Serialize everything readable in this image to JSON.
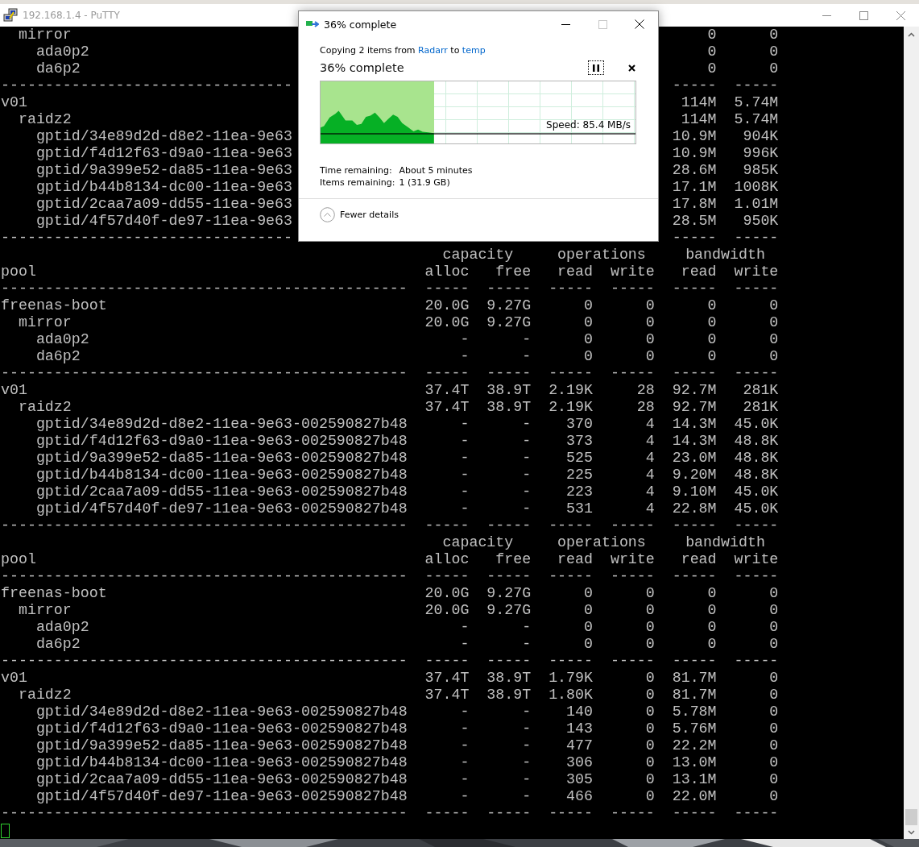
{
  "putty": {
    "title": "192.168.1.4 - PuTTY"
  },
  "terminal": {
    "lines": [
      {
        "kind": "pool",
        "children": [
          {
            "name": "mirror",
            "values": {
              "bw_read": "0",
              "bw_write": "0"
            },
            "children": [
              {
                "name": "ada0p2",
                "values": {
                  "bw_read": "0",
                  "bw_write": "0"
                }
              },
              {
                "name": "da6p2",
                "values": {
                  "bw_read": "0",
                  "bw_write": "0"
                }
              }
            ]
          }
        ]
      },
      {
        "kind": "separator",
        "name": "---------------------------------",
        "cells": {
          "bw_read": "-----",
          "bw_write": "-----"
        }
      },
      {
        "kind": "pool",
        "name": "v01",
        "values": {
          "bw_read": "114M",
          "bw_write": "5.74M"
        },
        "children": [
          {
            "name": "raidz2",
            "values": {
              "bw_read": "114M",
              "bw_write": "5.74M"
            },
            "children": [
              {
                "name": "gptid/34e89d2d-d8e2-11ea-9e63",
                "values": {
                  "bw_read": "10.9M",
                  "bw_write": "904K"
                }
              },
              {
                "name": "gptid/f4d12f63-d9a0-11ea-9e63",
                "values": {
                  "bw_read": "10.9M",
                  "bw_write": "996K"
                }
              },
              {
                "name": "gptid/9a399e52-da85-11ea-9e63",
                "values": {
                  "bw_read": "28.6M",
                  "bw_write": "985K"
                }
              },
              {
                "name": "gptid/b44b8134-dc00-11ea-9e63",
                "values": {
                  "bw_read": "17.1M",
                  "bw_write": "1008K"
                }
              },
              {
                "name": "gptid/2caa7a09-dd55-11ea-9e63",
                "values": {
                  "bw_read": "17.8M",
                  "bw_write": "1.01M"
                }
              },
              {
                "name": "gptid/4f57d40f-de97-11ea-9e63",
                "values": {
                  "bw_read": "28.5M",
                  "bw_write": "950K"
                }
              }
            ]
          }
        ]
      },
      {
        "kind": "separator",
        "name": "---------------------------------",
        "cells": {
          "bw_read": "-----",
          "bw_write": "-----"
        }
      },
      {
        "kind": "groups",
        "groups": [
          "capacity",
          "operations",
          "bandwidth"
        ]
      },
      {
        "kind": "columns",
        "label": "pool",
        "columns": [
          "alloc",
          "free",
          "read",
          "write",
          "read",
          "write"
        ]
      },
      {
        "kind": "separator",
        "name": "----------------------------------------------",
        "cells": {
          "alloc": "-----",
          "free": "-----",
          "ops_read": "-----",
          "ops_write": "-----",
          "bw_read": "-----",
          "bw_write": "-----"
        }
      },
      {
        "kind": "pool",
        "name": "freenas-boot",
        "values": {
          "alloc": "20.0G",
          "free": "9.27G",
          "ops_read": "0",
          "ops_write": "0",
          "bw_read": "0",
          "bw_write": "0"
        },
        "children": [
          {
            "name": "mirror",
            "values": {
              "alloc": "20.0G",
              "free": "9.27G",
              "ops_read": "0",
              "ops_write": "0",
              "bw_read": "0",
              "bw_write": "0"
            },
            "children": [
              {
                "name": "ada0p2",
                "values": {
                  "alloc": "-",
                  "free": "-",
                  "ops_read": "0",
                  "ops_write": "0",
                  "bw_read": "0",
                  "bw_write": "0"
                }
              },
              {
                "name": "da6p2",
                "values": {
                  "alloc": "-",
                  "free": "-",
                  "ops_read": "0",
                  "ops_write": "0",
                  "bw_read": "0",
                  "bw_write": "0"
                }
              }
            ]
          }
        ]
      },
      {
        "kind": "separator",
        "name": "----------------------------------------------",
        "cells": {
          "alloc": "-----",
          "free": "-----",
          "ops_read": "-----",
          "ops_write": "-----",
          "bw_read": "-----",
          "bw_write": "-----"
        }
      },
      {
        "kind": "pool",
        "name": "v01",
        "values": {
          "alloc": "37.4T",
          "free": "38.9T",
          "ops_read": "2.19K",
          "ops_write": "28",
          "bw_read": "92.7M",
          "bw_write": "281K"
        },
        "children": [
          {
            "name": "raidz2",
            "values": {
              "alloc": "37.4T",
              "free": "38.9T",
              "ops_read": "2.19K",
              "ops_write": "28",
              "bw_read": "92.7M",
              "bw_write": "281K"
            },
            "children": [
              {
                "name": "gptid/34e89d2d-d8e2-11ea-9e63-002590827b48",
                "values": {
                  "alloc": "-",
                  "free": "-",
                  "ops_read": "370",
                  "ops_write": "4",
                  "bw_read": "14.3M",
                  "bw_write": "45.0K"
                }
              },
              {
                "name": "gptid/f4d12f63-d9a0-11ea-9e63-002590827b48",
                "values": {
                  "alloc": "-",
                  "free": "-",
                  "ops_read": "373",
                  "ops_write": "4",
                  "bw_read": "14.3M",
                  "bw_write": "48.8K"
                }
              },
              {
                "name": "gptid/9a399e52-da85-11ea-9e63-002590827b48",
                "values": {
                  "alloc": "-",
                  "free": "-",
                  "ops_read": "525",
                  "ops_write": "4",
                  "bw_read": "23.0M",
                  "bw_write": "48.8K"
                }
              },
              {
                "name": "gptid/b44b8134-dc00-11ea-9e63-002590827b48",
                "values": {
                  "alloc": "-",
                  "free": "-",
                  "ops_read": "225",
                  "ops_write": "4",
                  "bw_read": "9.20M",
                  "bw_write": "48.8K"
                }
              },
              {
                "name": "gptid/2caa7a09-dd55-11ea-9e63-002590827b48",
                "values": {
                  "alloc": "-",
                  "free": "-",
                  "ops_read": "223",
                  "ops_write": "4",
                  "bw_read": "9.10M",
                  "bw_write": "45.0K"
                }
              },
              {
                "name": "gptid/4f57d40f-de97-11ea-9e63-002590827b48",
                "values": {
                  "alloc": "-",
                  "free": "-",
                  "ops_read": "531",
                  "ops_write": "4",
                  "bw_read": "22.8M",
                  "bw_write": "45.0K"
                }
              }
            ]
          }
        ]
      },
      {
        "kind": "separator",
        "name": "----------------------------------------------",
        "cells": {
          "alloc": "-----",
          "free": "-----",
          "ops_read": "-----",
          "ops_write": "-----",
          "bw_read": "-----",
          "bw_write": "-----"
        }
      },
      {
        "kind": "groups",
        "groups": [
          "capacity",
          "operations",
          "bandwidth"
        ]
      },
      {
        "kind": "columns",
        "label": "pool",
        "columns": [
          "alloc",
          "free",
          "read",
          "write",
          "read",
          "write"
        ]
      },
      {
        "kind": "separator",
        "name": "----------------------------------------------",
        "cells": {
          "alloc": "-----",
          "free": "-----",
          "ops_read": "-----",
          "ops_write": "-----",
          "bw_read": "-----",
          "bw_write": "-----"
        }
      },
      {
        "kind": "pool",
        "name": "freenas-boot",
        "values": {
          "alloc": "20.0G",
          "free": "9.27G",
          "ops_read": "0",
          "ops_write": "0",
          "bw_read": "0",
          "bw_write": "0"
        },
        "children": [
          {
            "name": "mirror",
            "values": {
              "alloc": "20.0G",
              "free": "9.27G",
              "ops_read": "0",
              "ops_write": "0",
              "bw_read": "0",
              "bw_write": "0"
            },
            "children": [
              {
                "name": "ada0p2",
                "values": {
                  "alloc": "-",
                  "free": "-",
                  "ops_read": "0",
                  "ops_write": "0",
                  "bw_read": "0",
                  "bw_write": "0"
                }
              },
              {
                "name": "da6p2",
                "values": {
                  "alloc": "-",
                  "free": "-",
                  "ops_read": "0",
                  "ops_write": "0",
                  "bw_read": "0",
                  "bw_write": "0"
                }
              }
            ]
          }
        ]
      },
      {
        "kind": "separator",
        "name": "----------------------------------------------",
        "cells": {
          "alloc": "-----",
          "free": "-----",
          "ops_read": "-----",
          "ops_write": "-----",
          "bw_read": "-----",
          "bw_write": "-----"
        }
      },
      {
        "kind": "pool",
        "name": "v01",
        "values": {
          "alloc": "37.4T",
          "free": "38.9T",
          "ops_read": "1.79K",
          "ops_write": "0",
          "bw_read": "81.7M",
          "bw_write": "0"
        },
        "children": [
          {
            "name": "raidz2",
            "values": {
              "alloc": "37.4T",
              "free": "38.9T",
              "ops_read": "1.80K",
              "ops_write": "0",
              "bw_read": "81.7M",
              "bw_write": "0"
            },
            "children": [
              {
                "name": "gptid/34e89d2d-d8e2-11ea-9e63-002590827b48",
                "values": {
                  "alloc": "-",
                  "free": "-",
                  "ops_read": "140",
                  "ops_write": "0",
                  "bw_read": "5.78M",
                  "bw_write": "0"
                }
              },
              {
                "name": "gptid/f4d12f63-d9a0-11ea-9e63-002590827b48",
                "values": {
                  "alloc": "-",
                  "free": "-",
                  "ops_read": "143",
                  "ops_write": "0",
                  "bw_read": "5.76M",
                  "bw_write": "0"
                }
              },
              {
                "name": "gptid/9a399e52-da85-11ea-9e63-002590827b48",
                "values": {
                  "alloc": "-",
                  "free": "-",
                  "ops_read": "477",
                  "ops_write": "0",
                  "bw_read": "22.2M",
                  "bw_write": "0"
                }
              },
              {
                "name": "gptid/b44b8134-dc00-11ea-9e63-002590827b48",
                "values": {
                  "alloc": "-",
                  "free": "-",
                  "ops_read": "306",
                  "ops_write": "0",
                  "bw_read": "13.0M",
                  "bw_write": "0"
                }
              },
              {
                "name": "gptid/2caa7a09-dd55-11ea-9e63-002590827b48",
                "values": {
                  "alloc": "-",
                  "free": "-",
                  "ops_read": "305",
                  "ops_write": "0",
                  "bw_read": "13.1M",
                  "bw_write": "0"
                }
              },
              {
                "name": "gptid/4f57d40f-de97-11ea-9e63-002590827b48",
                "values": {
                  "alloc": "-",
                  "free": "-",
                  "ops_read": "466",
                  "ops_write": "0",
                  "bw_read": "22.0M",
                  "bw_write": "0"
                }
              }
            ]
          }
        ]
      },
      {
        "kind": "separator",
        "name": "----------------------------------------------",
        "cells": {
          "alloc": "-----",
          "free": "-----",
          "ops_read": "-----",
          "ops_write": "-----",
          "bw_read": "-----",
          "bw_write": "-----"
        }
      }
    ]
  },
  "copy_dialog": {
    "title": "36% complete",
    "copy_line": {
      "prefix": "Copying 2 items from",
      "source": "Radarr",
      "middle": "to",
      "target": "temp"
    },
    "heading": "36% complete",
    "level": 0.36,
    "speed": "Speed: 85.4 MB/s",
    "details": [
      {
        "label": "Time remaining:",
        "value": "About 5 minutes"
      },
      {
        "label": "Items remaining:",
        "value": "1 (31.9 GB)"
      }
    ],
    "toggle": "Fewer details"
  }
}
